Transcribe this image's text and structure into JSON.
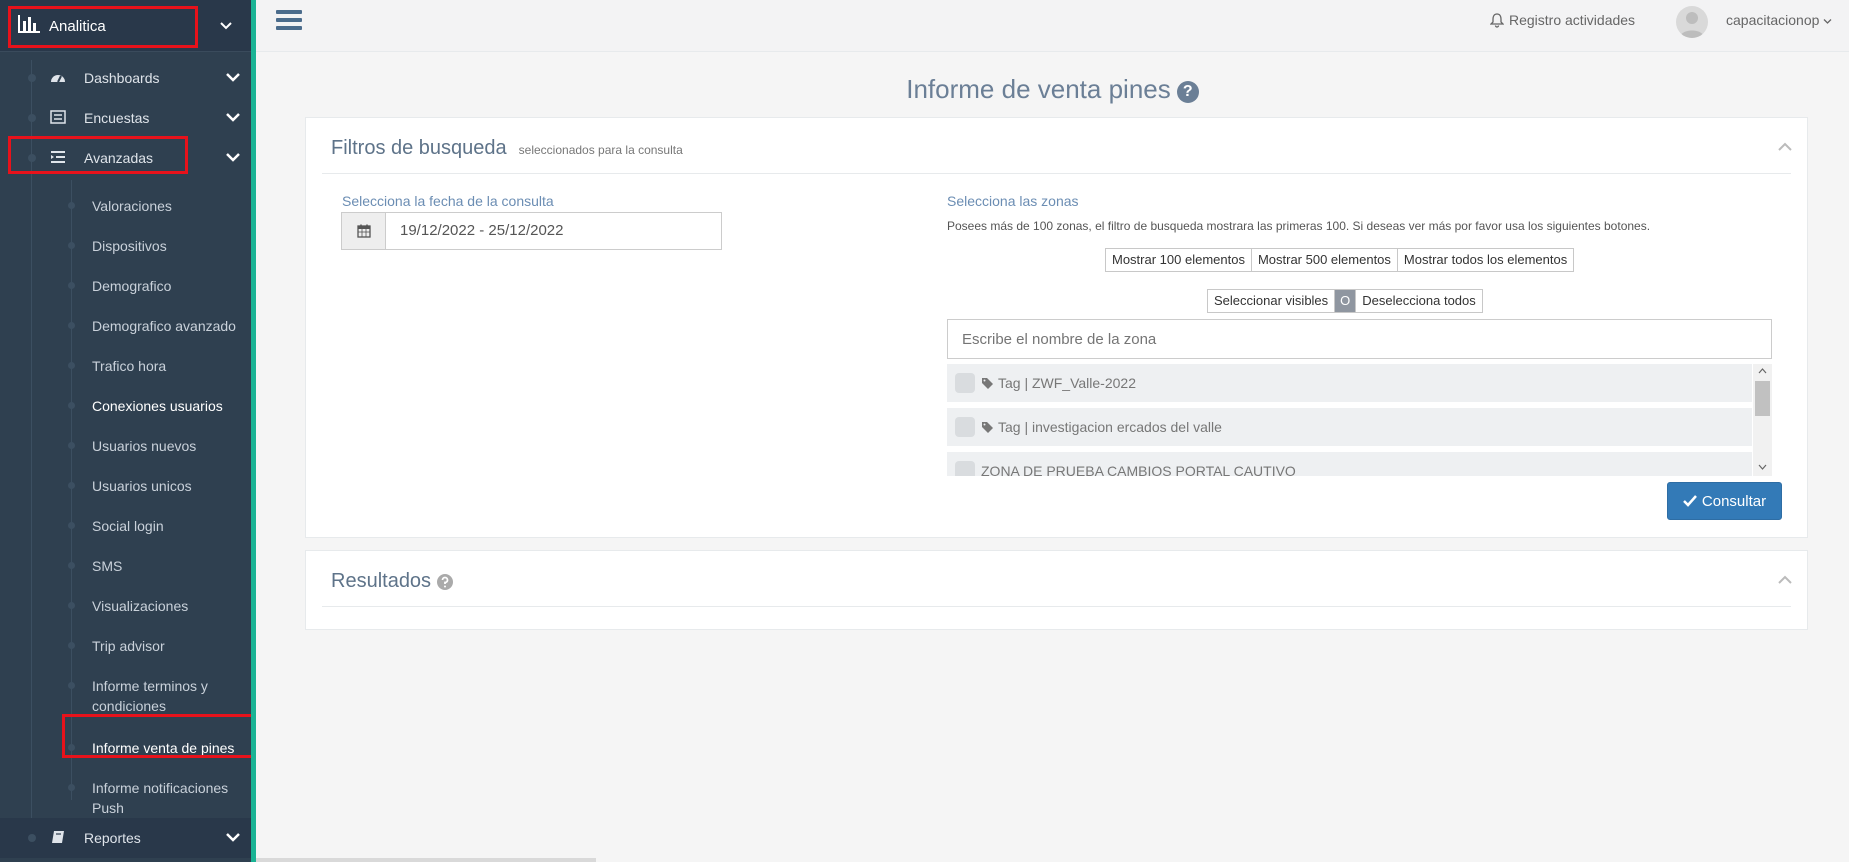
{
  "sidebar": {
    "top_label": "Analitica",
    "items": [
      {
        "label": "Dashboards"
      },
      {
        "label": "Encuestas"
      },
      {
        "label": "Avanzadas"
      },
      {
        "label": "Reportes"
      }
    ],
    "subitems": [
      "Valoraciones",
      "Dispositivos",
      "Demografico",
      "Demografico avanzado",
      "Trafico hora",
      "Conexiones usuarios",
      "Usuarios nuevos",
      "Usuarios unicos",
      "Social login",
      "SMS",
      "Visualizaciones",
      "Trip advisor",
      "Informe terminos y condiciones",
      "Informe venta de pines",
      "Informe notificaciones Push"
    ]
  },
  "topbar": {
    "registro": "Registro actividades",
    "user": "capacitacionop"
  },
  "page": {
    "title": "Informe de venta pines",
    "help": "?"
  },
  "filters": {
    "title": "Filtros de busqueda",
    "subtitle": "seleccionados para la consulta",
    "date_label": "Selecciona la fecha de la consulta",
    "date_value": "19/12/2022 - 25/12/2022",
    "zones_label": "Selecciona las zonas",
    "zones_hint": "Posees más de 100 zonas, el filtro de busqueda mostrara las primeras 100. Si deseas ver más por favor usa los siguientes botones.",
    "show_buttons": [
      "Mostrar 100 elementos",
      "Mostrar 500 elementos",
      "Mostrar todos los elementos"
    ],
    "select_visible": "Seleccionar visibles",
    "select_mid": "O",
    "deselect_all": "Deselecciona todos",
    "zone_placeholder": "Escribe el nombre de la zona",
    "zones": [
      "Tag | ZWF_Valle-2022",
      "Tag | investigacion ercados del valle",
      "ZONA DE PRUEBA CAMBIOS PORTAL CAUTIVO"
    ],
    "consultar": "Consultar"
  },
  "results": {
    "title": "Resultados"
  },
  "colors": {
    "sidebar_bg": "#2f4050",
    "accent": "#1ab394",
    "primary": "#337ab7",
    "highlight": "#e8121b"
  }
}
